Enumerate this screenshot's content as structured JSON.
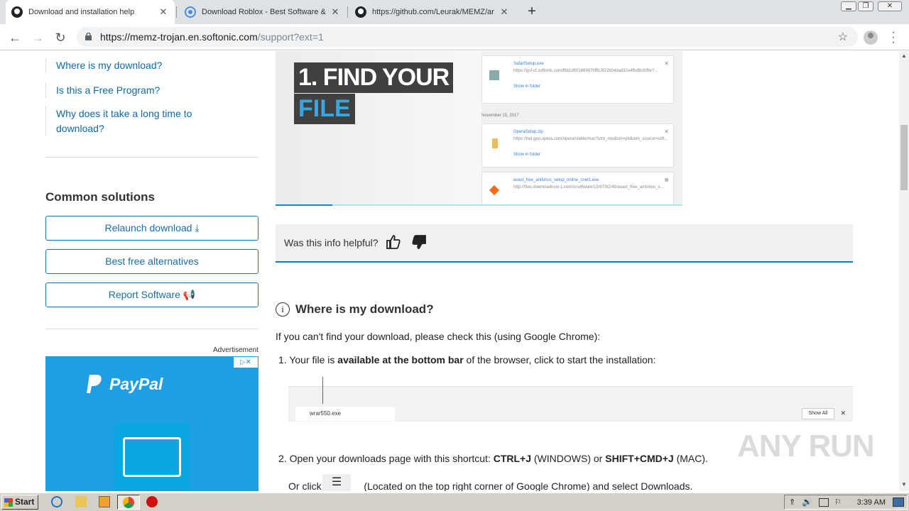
{
  "browser": {
    "tabs": [
      {
        "title": "Download and installation help",
        "active": true
      },
      {
        "title": "Download Roblox - Best Software &",
        "active": false
      },
      {
        "title": "https://github.com/Leurak/MEMZ/ar",
        "active": false
      }
    ],
    "new_tab": "+",
    "url_host": "https://memz-trojan.en.softonic.com",
    "url_path": "/support?ext=1"
  },
  "sidebar": {
    "links": [
      "Where is my download?",
      "Is this a Free Program?",
      "Why does it take a long time to",
      "download?"
    ],
    "common_title": "Common solutions",
    "buttons": [
      "Relaunch download",
      "Best free alternatives",
      "Report Software"
    ],
    "ad_label": "Advertisement",
    "ad_brand": "PayPal"
  },
  "screenshot": {
    "line1": "1. FIND YOUR",
    "line2": "FILE",
    "date": "November 15, 2017",
    "cards": [
      {
        "name": "SafariSetup.exe",
        "url": "https://gsf-cf.softonic.com/f6b1df/0186987bfffc3f22b04dad32e4fbd9c6/file?...",
        "show": "Show in folder"
      },
      {
        "name": "OperaSetup.zip",
        "url": "https://net.geo.opera.com/opera/stable/mac?utm_medium=pb&utm_source=soft...",
        "show": "Show in folder"
      },
      {
        "name": "avast_free_antivirus_setup_online_cnet1.exe",
        "url": "http://files.downloadnow-1.com/s/software/15/97/82/46/avast_free_antivirus_s...",
        "show": ""
      }
    ]
  },
  "feedback": {
    "question": "Was this info helpful?"
  },
  "content": {
    "heading": "Where is my download?",
    "intro": "If you can't find your download, please check this (using Google Chrome):",
    "step1_pre": "1. Your file is ",
    "step1_bold": "available at the bottom bar",
    "step1_post": " of the browser, click to start the installation:",
    "bar_file": "wrar550.exe",
    "bar_show_all": "Show All",
    "step2_pre": "2. Open your downloads page with this shortcut: ",
    "step2_k1": "CTRL+J",
    "step2_mid": " (WINDOWS) or ",
    "step2_k2": "SHIFT+CMD+J",
    "step2_post": " (MAC).",
    "orclick_pre": "Or click: ",
    "orclick_post": " (Located on the top right corner of Google Chrome) and select Downloads."
  },
  "watermark": "ANY RUN",
  "taskbar": {
    "start": "Start",
    "time": "3:39 AM"
  }
}
